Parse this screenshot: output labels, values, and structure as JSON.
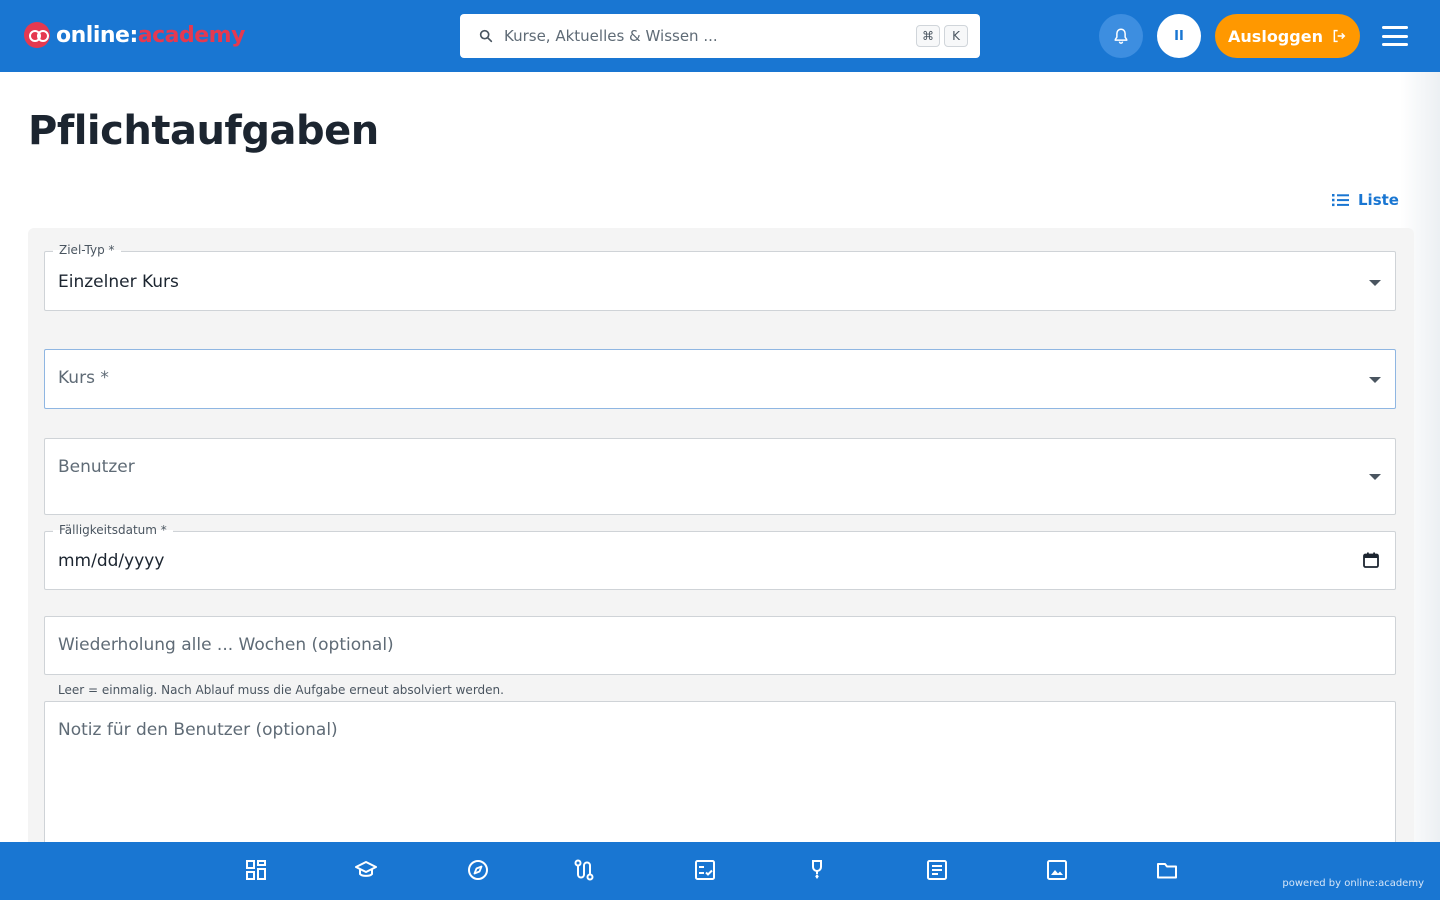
{
  "header": {
    "logo_part1": "online:",
    "logo_part2": "academy",
    "search_placeholder": "Kurse, Aktuelles & Wissen ...",
    "shortcut_key1": "⌘",
    "shortcut_key2": "K",
    "avatar_initials": "II",
    "logout_label": "Ausloggen"
  },
  "page": {
    "title": "Pflichtaufgaben",
    "view_toggle_label": "Liste"
  },
  "form": {
    "target_type": {
      "label": "Ziel-Typ *",
      "value": "Einzelner Kurs"
    },
    "course": {
      "placeholder": "Kurs *"
    },
    "users": {
      "placeholder": "Benutzer"
    },
    "due_date": {
      "label": "Fälligkeitsdatum *",
      "value": "mm/dd/yyyy"
    },
    "repeat": {
      "placeholder": "Wiederholung alle ... Wochen (optional)",
      "helper": "Leer = einmalig. Nach Ablauf muss die Aufgabe erneut absolviert werden."
    },
    "note": {
      "placeholder": "Notiz für den Benutzer (optional)"
    }
  },
  "bottom_nav": {
    "items": [
      "dashboard-icon",
      "graduation-cap-icon",
      "compass-icon",
      "route-icon",
      "checklist-icon",
      "award-icon",
      "article-icon",
      "image-icon",
      "folder-icon"
    ],
    "powered_by": "powered by online:academy"
  },
  "colors": {
    "primary": "#1976d2",
    "accent": "#ff9800",
    "brand_red": "#e53950",
    "card_bg": "#f4f4f4"
  }
}
